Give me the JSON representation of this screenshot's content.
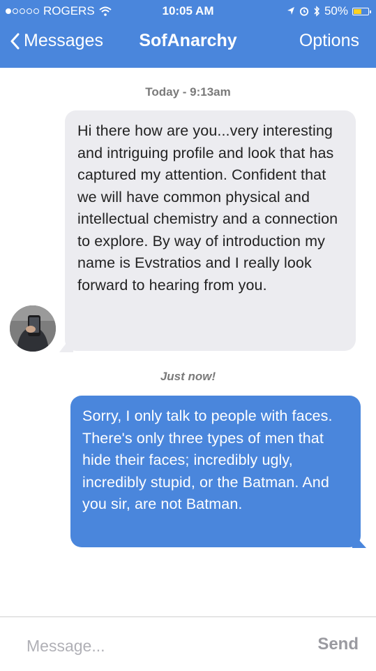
{
  "status_bar": {
    "carrier": "ROGERS",
    "time": "10:05 AM",
    "battery": "50%",
    "battery_level": 0.5,
    "signal_bars_filled": 1,
    "signal_bars_total": 5
  },
  "nav": {
    "back_label": "Messages",
    "title": "SofAnarchy",
    "options_label": "Options"
  },
  "conversation": {
    "timestamp_1": "Today - 9:13am",
    "incoming_message": "Hi there how are you...very interesting and intriguing profile and look that has captured my attention. Confident that we will have common physical and intellectual chemistry and a connection to explore. By way of introduction my name is Evstratios and I really look forward to hearing from you.",
    "timestamp_2": "Just now!",
    "outgoing_message": "Sorry, I only talk to people with faces. There's only three types of men that hide their faces; incredibly ugly, incredibly stupid, or the Batman. And you sir, are not Batman."
  },
  "composer": {
    "placeholder": "Message...",
    "send_label": "Send"
  },
  "colors": {
    "accent": "#4a86dc",
    "incoming_bubble": "#ececf0",
    "battery_fill": "#ffd21f"
  }
}
